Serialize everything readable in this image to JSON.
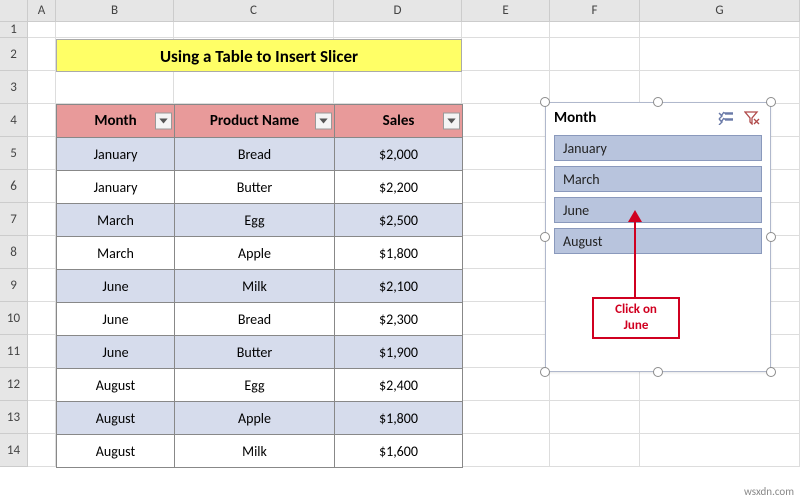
{
  "columns": [
    "A",
    "B",
    "C",
    "D",
    "E",
    "F",
    "G"
  ],
  "rows": [
    "1",
    "2",
    "3",
    "4",
    "5",
    "6",
    "7",
    "8",
    "9",
    "10",
    "11",
    "12",
    "13",
    "14"
  ],
  "title": "Using a Table to Insert Slicer",
  "table": {
    "headers": {
      "month": "Month",
      "product": "Product Name",
      "sales": "Sales"
    },
    "rows": [
      {
        "month": "January",
        "product": "Bread",
        "sales": "$2,000"
      },
      {
        "month": "January",
        "product": "Butter",
        "sales": "$2,200"
      },
      {
        "month": "March",
        "product": "Egg",
        "sales": "$2,500"
      },
      {
        "month": "March",
        "product": "Apple",
        "sales": "$1,800"
      },
      {
        "month": "June",
        "product": "Milk",
        "sales": "$2,100"
      },
      {
        "month": "June",
        "product": "Bread",
        "sales": "$2,300"
      },
      {
        "month": "June",
        "product": "Butter",
        "sales": "$1,900"
      },
      {
        "month": "August",
        "product": "Egg",
        "sales": "$2,400"
      },
      {
        "month": "August",
        "product": "Apple",
        "sales": "$1,800"
      },
      {
        "month": "August",
        "product": "Milk",
        "sales": "$1,600"
      }
    ]
  },
  "slicer": {
    "title": "Month",
    "items": [
      "January",
      "March",
      "June",
      "August"
    ]
  },
  "callout": "Click on\nJune",
  "watermark": "wsxdn.com",
  "colors": {
    "titleBg": "#ffff66",
    "headerBg": "#e89a9a",
    "bandBg": "#d6dcec",
    "slicerItem": "#b8c4dd",
    "calloutBorder": "#d00020"
  }
}
